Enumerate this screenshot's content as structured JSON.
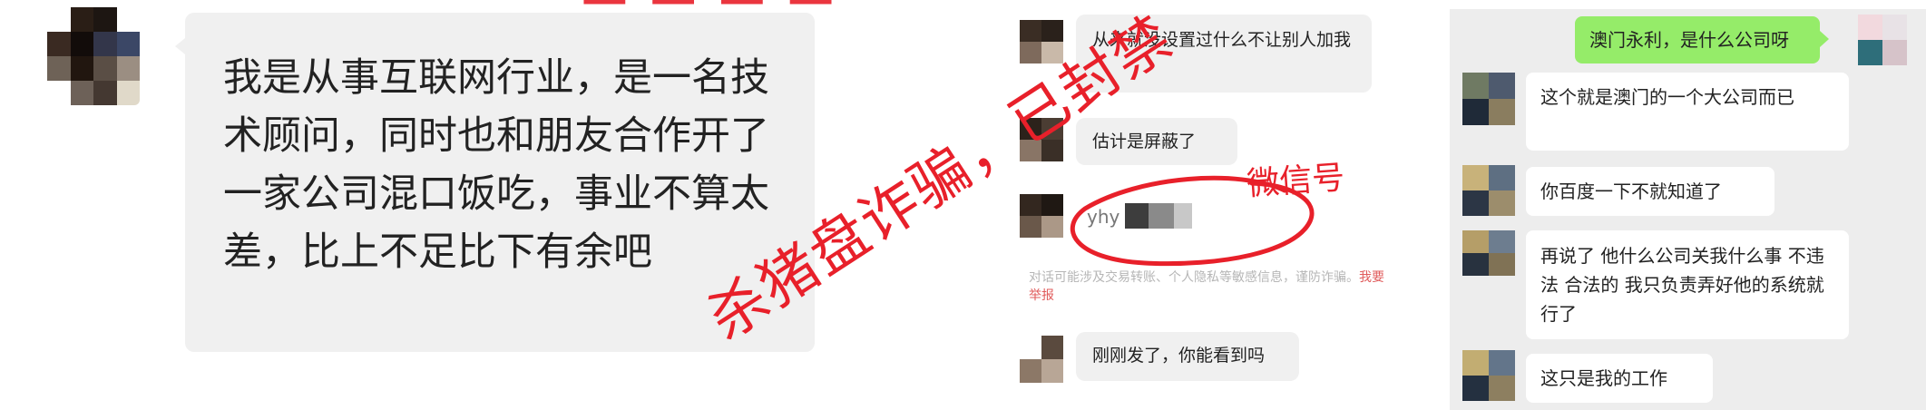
{
  "panel1": {
    "message": "我是从事互联网行业，是一名技术顾问，同时也和朋友合作开了一家公司混口饭吃，事业不算太差，比上不足比下有余吧"
  },
  "panel2": {
    "messages": [
      "从来就没设置过什么不让别人加我",
      "估计是屏蔽了",
      "yhy",
      "刚刚发了，你能看到吗"
    ],
    "warning_text": "对话可能涉及交易转账、个人隐私等敏感信息，谨防诈骗。",
    "report_link": "我要举报",
    "annotation_wechat": "微信号"
  },
  "panel3": {
    "outgoing": "澳门永利，是什么公司呀",
    "messages": [
      "这个就是澳门的一个大公司而已",
      "你百度一下不就知道了",
      "再说了 他什么公司关我什么事 不违法 合法的 我只负责弄好他的系统就行了",
      "这只是我的工作"
    ]
  },
  "stamps": {
    "scam": "杀猪盘诈骗，已封禁"
  },
  "colors": {
    "stamp_red": "#e8202a",
    "bubble_grey": "#f0f0f0",
    "bubble_green": "#95ec69",
    "panel3_bg": "#ededed"
  }
}
